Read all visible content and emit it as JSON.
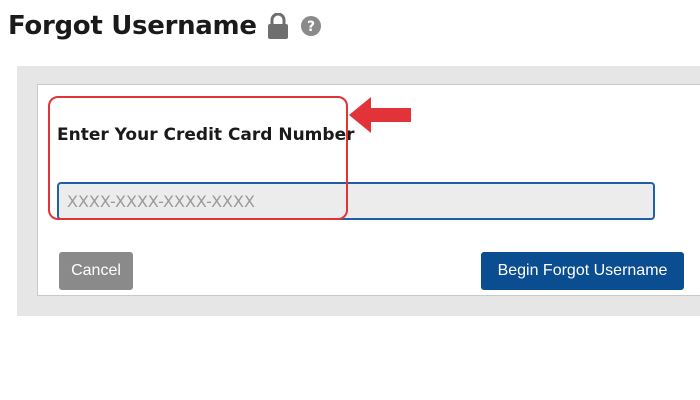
{
  "header": {
    "title": "Forgot Username",
    "icons": [
      "lock-icon",
      "help-circle-icon"
    ]
  },
  "form": {
    "card_label": "Enter Your Credit Card Number",
    "card_input": {
      "value": "",
      "placeholder": "XXXX-XXXX-XXXX-XXXX"
    },
    "cancel_label": "Cancel",
    "submit_label": "Begin Forgot Username"
  },
  "annotation": {
    "icon": "arrow-left-icon",
    "color": "#e2323a"
  },
  "colors": {
    "primary_button": "#0b4d91",
    "cancel_button": "#8a8a8a",
    "input_border": "#1f5fa8",
    "panel_background": "#e6e6e6"
  }
}
